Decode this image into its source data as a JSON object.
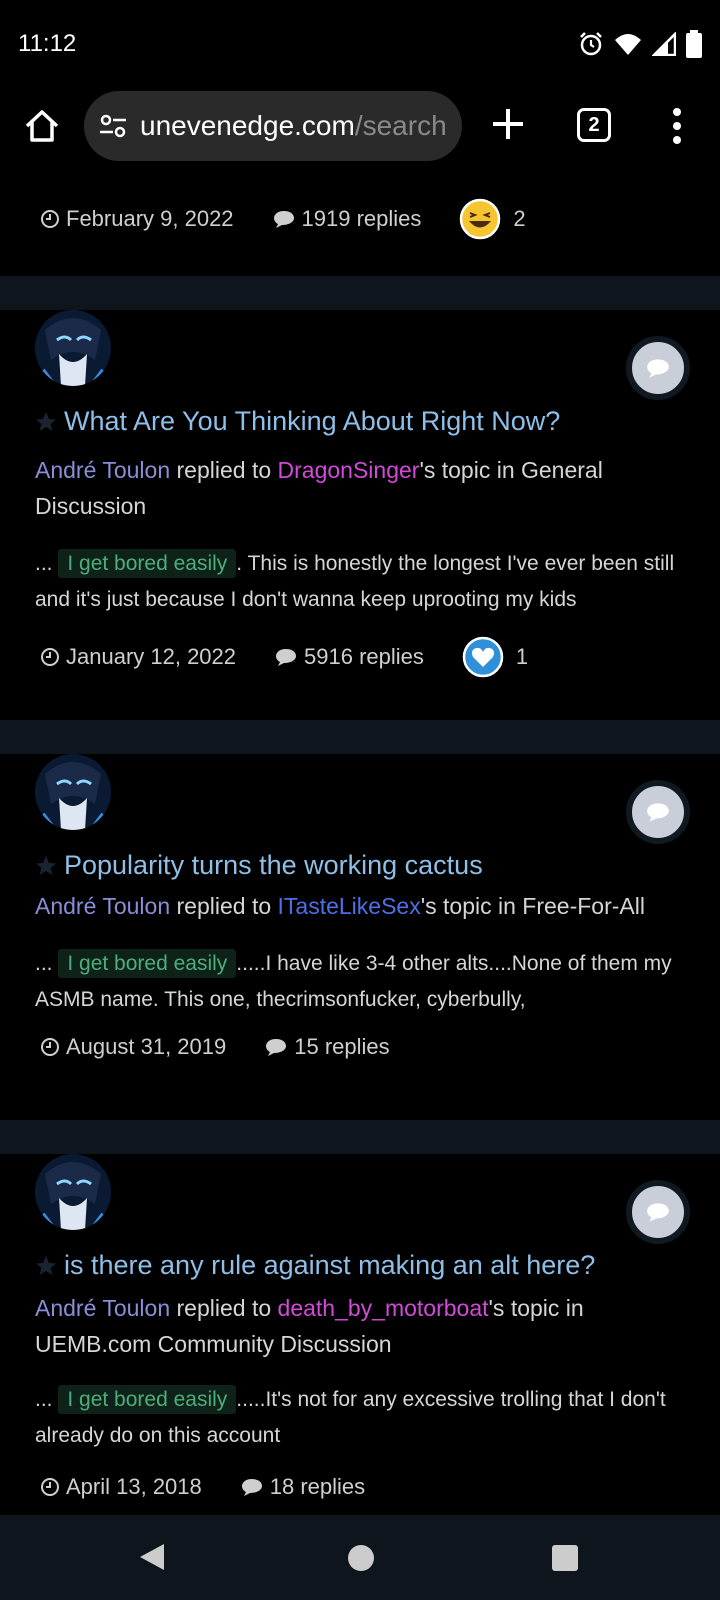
{
  "status_bar": {
    "time": "11:12"
  },
  "browser": {
    "url_domain": "unevenedge.com",
    "url_path": "/search",
    "tab_count": "2"
  },
  "top_meta": {
    "date": "February 9, 2022",
    "replies": "1919 replies",
    "reaction_count": "2"
  },
  "results": [
    {
      "title": "What Are You Thinking About Right Now?",
      "author": "André Toulon",
      "replied_to": " replied to ",
      "starter": "DragonSinger",
      "topic_in": "'s topic in General Discussion",
      "snippet_prefix": "... ",
      "highlight": "I get bored easily",
      "snippet_rest": ". This is honestly the longest I've ever been still and it's just because I don't wanna keep uprooting my kids",
      "date": "January 12, 2022",
      "replies": "5916 replies",
      "reaction_count": "1"
    },
    {
      "title": "Popularity turns the working cactus",
      "author": "André Toulon",
      "replied_to": " replied to ",
      "starter": "ITasteLikeSex",
      "topic_in": "'s topic in Free-For-All",
      "snippet_prefix": "... ",
      "highlight": "I get bored easily",
      "snippet_rest": ".....I have like 3-4 other alts....None of them my ASMB name. This one, thecrimsonfucker, cyberbully,",
      "date": "August 31, 2019",
      "replies": "15 replies"
    },
    {
      "title": "is there any rule against making an alt here?",
      "author": "André Toulon",
      "replied_to": " replied to ",
      "starter": "death_by_motorboat",
      "topic_in": "'s topic in UEMB.com Community Discussion",
      "snippet_prefix": "... ",
      "highlight": "I get bored easily",
      "snippet_rest": ".....It's not for any excessive trolling that I don't already do on this account",
      "date": "April 13, 2018",
      "replies": "18 replies"
    }
  ],
  "colors": {
    "link": "#8dbfe8",
    "author": "#8a8ed8",
    "starter": "#d24bd8",
    "highlight_text": "#4cae7a",
    "divider": "#0f151c"
  },
  "icons": [
    "alarm-icon",
    "wifi-icon",
    "signal-icon",
    "battery-icon",
    "home-icon",
    "site-settings-icon",
    "plus-icon",
    "tab-switcher-icon",
    "more-icon",
    "clock-icon",
    "comment-icon",
    "haha-reaction-icon",
    "like-reaction-icon",
    "star-icon"
  ]
}
